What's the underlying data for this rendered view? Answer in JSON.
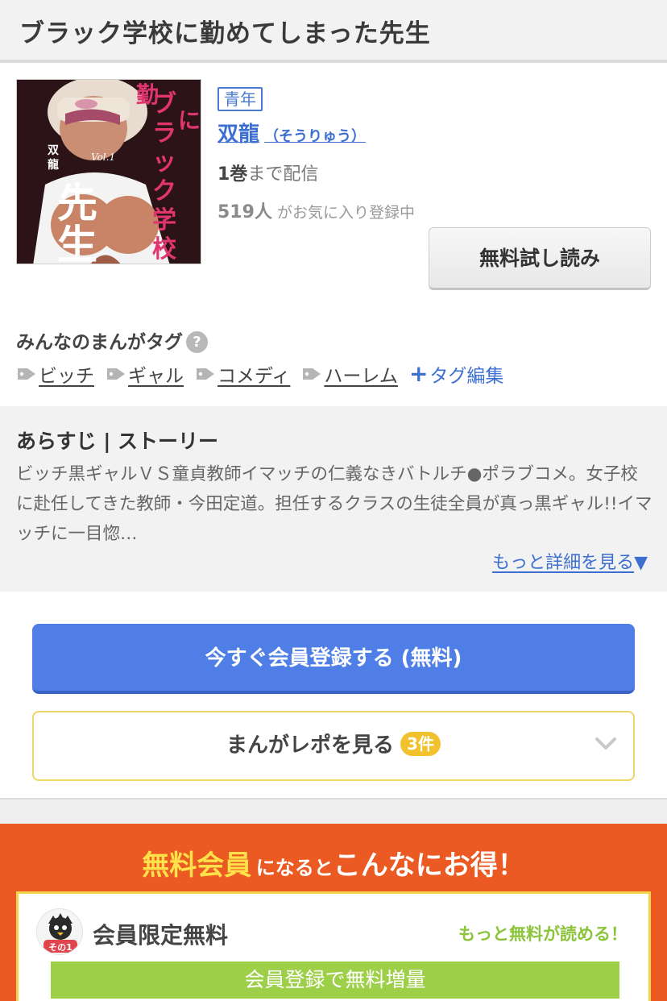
{
  "page": {
    "title": "ブラック学校に勤めてしまった先生"
  },
  "cover": {
    "alt_title_chars": "ブラック学校に勤めてしまった先生",
    "author_on_cover": "双龍",
    "volume_mark": "Vol.1"
  },
  "book": {
    "genre": "青年",
    "author": "双龍",
    "author_kana": "（そうりゅう）",
    "volumes_num": "1巻",
    "volumes_suffix": "まで配信",
    "fav_count": "519人",
    "fav_suffix": "がお気に入り登録中"
  },
  "trial_button": {
    "label": "無料試し読み"
  },
  "tags": {
    "heading": "みんなのまんがタグ",
    "help_glyph": "?",
    "items": [
      "ビッチ",
      "ギャル",
      "コメディ",
      "ハーレム"
    ],
    "edit_label": "タグ編集",
    "edit_glyph": "+"
  },
  "synopsis": {
    "heading": "あらすじ | ストーリー",
    "text": "ビッチ黒ギャルＶＳ童貞教師イマッチの仁義なきバトルチ●ポラブコメ。女子校に赴任してきた教師・今田定道。担任するクラスの生徒全員が真っ黒ギャル!!イマッチに一目惚…",
    "more_label": "もっと詳細を見る",
    "more_glyph": "▼"
  },
  "register_button": {
    "label": "今すぐ会員登録する (無料)"
  },
  "repo_button": {
    "label": "まんがレポを見る",
    "count": "3件"
  },
  "benefits": {
    "heading_highlight": "無料会員",
    "heading_mid": "になると",
    "heading_big": "こんなにお得！",
    "card": {
      "badge": "その1",
      "title": "会員限定無料",
      "tagline": "もっと無料が読める！",
      "bar": "会員登録で無料増量"
    }
  },
  "colors": {
    "link_blue": "#3d6fd0",
    "register_blue": "#4f7fe6",
    "benefits_orange": "#ea5a22",
    "highlight_yellow": "#ffe14a",
    "count_badge_yellow": "#f2c22e",
    "benefit_green": "#9dcf48"
  },
  "icons": [
    "help-icon",
    "tag-icon",
    "plus-icon",
    "chevron-down-icon",
    "mascot-icon"
  ]
}
